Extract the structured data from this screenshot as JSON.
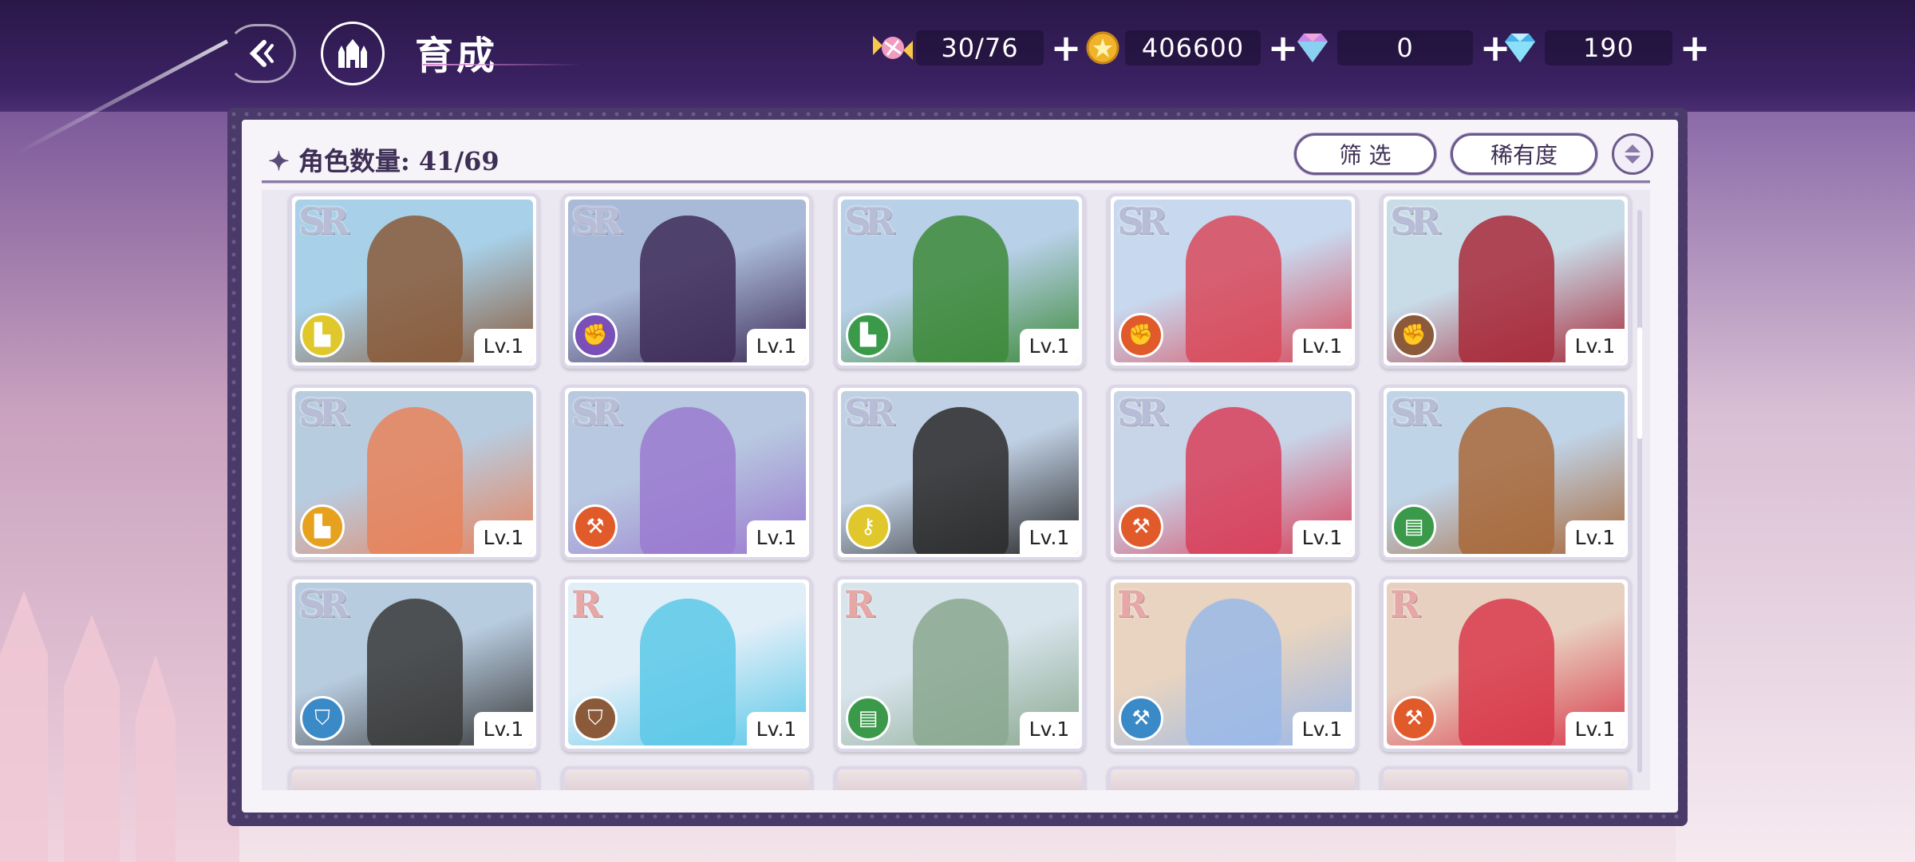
{
  "header": {
    "title": "育成",
    "resources": [
      {
        "name": "candy",
        "icon": "candy-icon",
        "value": "30/76"
      },
      {
        "name": "coin",
        "icon": "gold-coin-icon",
        "value": "406600"
      },
      {
        "name": "gem_pink",
        "icon": "pink-diamond-icon",
        "value": "0"
      },
      {
        "name": "gem_blue",
        "icon": "blue-diamond-icon",
        "value": "190"
      }
    ]
  },
  "panel": {
    "count_label": "角色数量: 41/69",
    "filter_label": "筛 选",
    "rarity_label": "稀有度"
  },
  "characters": [
    {
      "rarity": "SR",
      "level": "Lv.1",
      "element": "boot",
      "color": "#e0c82c",
      "art": [
        "#a8d0e8",
        "#8a5a3a"
      ]
    },
    {
      "rarity": "SR",
      "level": "Lv.1",
      "element": "fist",
      "color": "#7a4fb8",
      "art": [
        "#a9b9d8",
        "#3e2c58"
      ]
    },
    {
      "rarity": "SR",
      "level": "Lv.1",
      "element": "boot",
      "color": "#3a9a4a",
      "art": [
        "#b8d0e8",
        "#3d8a3a"
      ]
    },
    {
      "rarity": "SR",
      "level": "Lv.1",
      "element": "fist",
      "color": "#e05a2a",
      "art": [
        "#c8d8ee",
        "#d84a5a"
      ]
    },
    {
      "rarity": "SR",
      "level": "Lv.1",
      "element": "fist",
      "color": "#8a5a3a",
      "art": [
        "#c8dce8",
        "#a82a3a"
      ]
    },
    {
      "rarity": "SR",
      "level": "Lv.1",
      "element": "boot",
      "color": "#e6a21e",
      "art": [
        "#b8cce0",
        "#e8825a"
      ]
    },
    {
      "rarity": "SR",
      "level": "Lv.1",
      "element": "hammer",
      "color": "#e05a2a",
      "art": [
        "#b8c8e0",
        "#9a7ad0"
      ]
    },
    {
      "rarity": "SR",
      "level": "Lv.1",
      "element": "key",
      "color": "#e0c82c",
      "art": [
        "#c0d0e4",
        "#2a2a2a"
      ]
    },
    {
      "rarity": "SR",
      "level": "Lv.1",
      "element": "hammer",
      "color": "#e05a2a",
      "art": [
        "#c8d4e8",
        "#d8405a"
      ]
    },
    {
      "rarity": "SR",
      "level": "Lv.1",
      "element": "book",
      "color": "#3a9a4a",
      "art": [
        "#c0d4e8",
        "#a8683a"
      ]
    },
    {
      "rarity": "SR",
      "level": "Lv.1",
      "element": "shield",
      "color": "#3a8ac8",
      "art": [
        "#b8cce0",
        "#3a3a3a"
      ]
    },
    {
      "rarity": "R",
      "level": "Lv.1",
      "element": "shield",
      "color": "#8a5a3a",
      "art": [
        "#e0eef8",
        "#5ac8e8"
      ]
    },
    {
      "rarity": "R",
      "level": "Lv.1",
      "element": "book",
      "color": "#3a9a4a",
      "art": [
        "#d8e4ec",
        "#8aa890"
      ]
    },
    {
      "rarity": "R",
      "level": "Lv.1",
      "element": "hammer",
      "color": "#3a8ac8",
      "art": [
        "#e8d4c0",
        "#9ab8e8"
      ]
    },
    {
      "rarity": "R",
      "level": "Lv.1",
      "element": "hammer",
      "color": "#e05a2a",
      "art": [
        "#e8d0c0",
        "#d83a4a"
      ]
    }
  ]
}
